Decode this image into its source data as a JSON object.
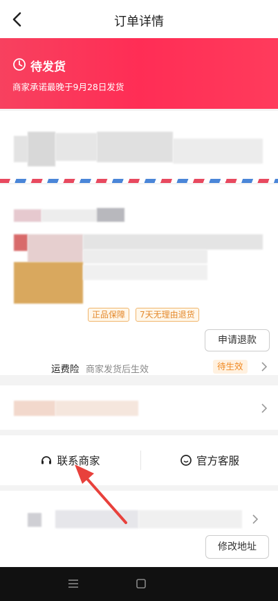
{
  "header": {
    "title": "订单详情",
    "back_icon": "chevron-left-icon"
  },
  "status": {
    "title": "待发货",
    "subtitle": "商家承诺最晚于9月28日发货",
    "icon": "clock-icon"
  },
  "product": {
    "badges": [
      "正品保障",
      "7天无理由退货"
    ],
    "refund_button": "申请退款"
  },
  "insurance": {
    "label": "运费险",
    "description": "商家发货后生效",
    "status": "待生效"
  },
  "contact": {
    "merchant": "联系商家",
    "service": "官方客服"
  },
  "address_action": {
    "modify_button": "修改地址"
  },
  "colors": {
    "banner_start": "#f7415f",
    "banner_end": "#ff3b5c",
    "badge_text": "#e4892c",
    "pending_bg": "#fff1e0",
    "arrow": "#e8413c"
  }
}
